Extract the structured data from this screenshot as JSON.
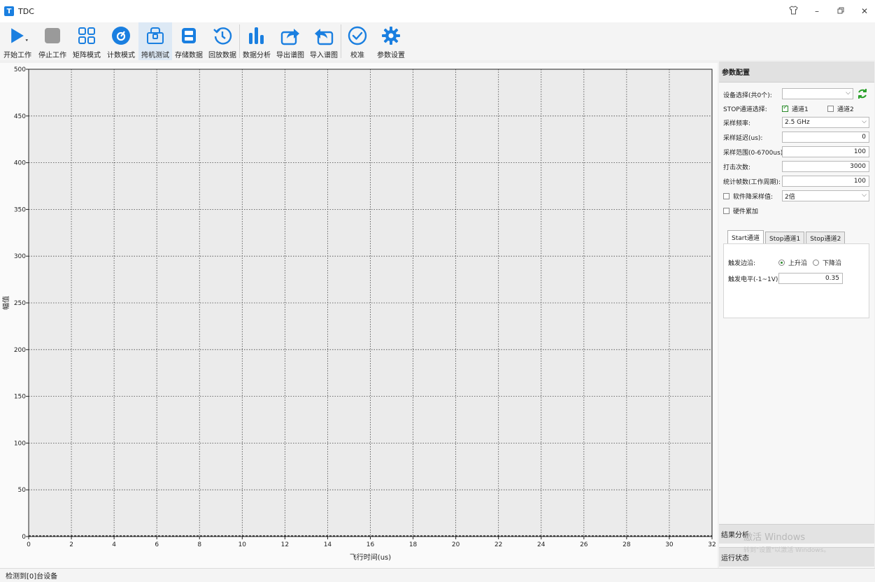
{
  "window": {
    "title": "TDC",
    "icon_letter": "T"
  },
  "toolbar": [
    {
      "label": "开始工作",
      "icon": "play-icon"
    },
    {
      "label": "停止工作",
      "icon": "stop-icon"
    },
    {
      "label": "矩阵模式",
      "icon": "grid-icon"
    },
    {
      "label": "计数模式",
      "icon": "disc-icon"
    },
    {
      "label": "挎机测试",
      "icon": "briefcase-icon"
    },
    {
      "label": "存储数据",
      "icon": "save-icon"
    },
    {
      "label": "回放数据",
      "icon": "replay-icon"
    },
    {
      "label": "数据分析",
      "icon": "bar-chart-icon"
    },
    {
      "label": "导出谱图",
      "icon": "export-icon"
    },
    {
      "label": "导入谱图",
      "icon": "import-icon"
    },
    {
      "label": "校准",
      "icon": "check-circle-icon"
    },
    {
      "label": "参数设置",
      "icon": "gear-icon"
    }
  ],
  "chart_data": {
    "type": "line",
    "series": [],
    "xlabel": "飞行时间(us)",
    "ylabel": "幅值",
    "xlim": [
      0,
      32
    ],
    "ylim": [
      0,
      500
    ],
    "xticks": [
      0,
      2,
      4,
      6,
      8,
      10,
      12,
      14,
      16,
      18,
      20,
      22,
      24,
      26,
      28,
      30,
      32
    ],
    "yticks": [
      0,
      50,
      100,
      150,
      200,
      250,
      300,
      350,
      400,
      450,
      500
    ],
    "grid": true
  },
  "panel": {
    "title": "参数配置",
    "device_label": "设备选择(共0个):",
    "device_value": "",
    "stop_channel_label": "STOP通道选择:",
    "channel1": "通道1",
    "channel1_checked": true,
    "channel2": "通道2",
    "channel2_checked": false,
    "sample_freq_label": "采样频率:",
    "sample_freq_value": "2.5 GHz",
    "sample_delay_label": "采样延迟(us):",
    "sample_delay_value": "0",
    "sample_range_label": "采样范围(0-6700us):",
    "sample_range_value": "100",
    "hit_count_label": "打击次数:",
    "hit_count_value": "3000",
    "stat_frames_label": "统计帧数(工作周期):",
    "stat_frames_value": "100",
    "soft_downsample_label": "软件降采样值:",
    "soft_downsample_checked": false,
    "soft_downsample_value": "2倍",
    "hw_accumulate_label": "硬件累加",
    "hw_accumulate_checked": false,
    "tabs": [
      "Start通道",
      "Stop通道1",
      "Stop通道2"
    ],
    "trigger_edge_label": "触发边沿:",
    "rising_edge": "上升沿",
    "falling_edge": "下降沿",
    "trigger_level_label": "触发电平(-1~1V):",
    "trigger_level_value": "0.35"
  },
  "sections": {
    "result": "结果分析",
    "status": "运行状态"
  },
  "watermark": {
    "line1": "激活 Windows",
    "line2": "转到\"设置\"以激活 Windows。"
  },
  "statusbar": {
    "text": "检测到[0]台设备"
  },
  "colors": {
    "accent": "#1a7fe0",
    "refresh": "#2aa02a"
  }
}
